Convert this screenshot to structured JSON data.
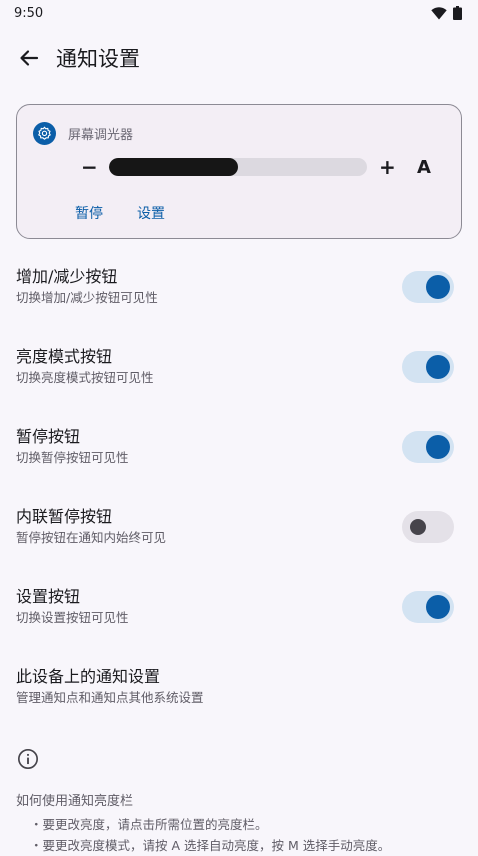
{
  "status": {
    "time": "9:50",
    "icons": [
      "wifi-icon",
      "battery-icon"
    ]
  },
  "appbar": {
    "title": "通知设置",
    "back_icon": "arrow-left-icon"
  },
  "notification_card": {
    "app_name": "屏幕调光器",
    "app_icon": "settings-gear-icon",
    "minus": "−",
    "plus": "+",
    "auto": "A",
    "brightness_level": 0.5,
    "actions": [
      "暂停",
      "设置"
    ]
  },
  "settings": [
    {
      "title": "增加/减少按钮",
      "subtitle": "切换增加/减少按钮可见性",
      "enabled": true
    },
    {
      "title": "亮度模式按钮",
      "subtitle": "切换亮度模式按钮可见性",
      "enabled": true
    },
    {
      "title": "暂停按钮",
      "subtitle": "切换暂停按钮可见性",
      "enabled": true
    },
    {
      "title": "内联暂停按钮",
      "subtitle": "暂停按钮在通知内始终可见",
      "enabled": false
    },
    {
      "title": "设置按钮",
      "subtitle": "切换设置按钮可见性",
      "enabled": true
    }
  ],
  "system_settings": {
    "title": "此设备上的通知设置",
    "subtitle": "管理通知点和通知点其他系统设置"
  },
  "help": {
    "icon": "info-icon",
    "title": "如何使用通知亮度栏",
    "items": [
      "・要更改亮度，请点击所需位置的亮度栏。",
      "・要更改亮度模式，请按 A 选择自动亮度，按 M 选择手动亮度。"
    ]
  },
  "colors": {
    "accent": "#0b5ea8",
    "toggle_track_on": "#d3e3f2",
    "background": "#f8f6fb"
  }
}
